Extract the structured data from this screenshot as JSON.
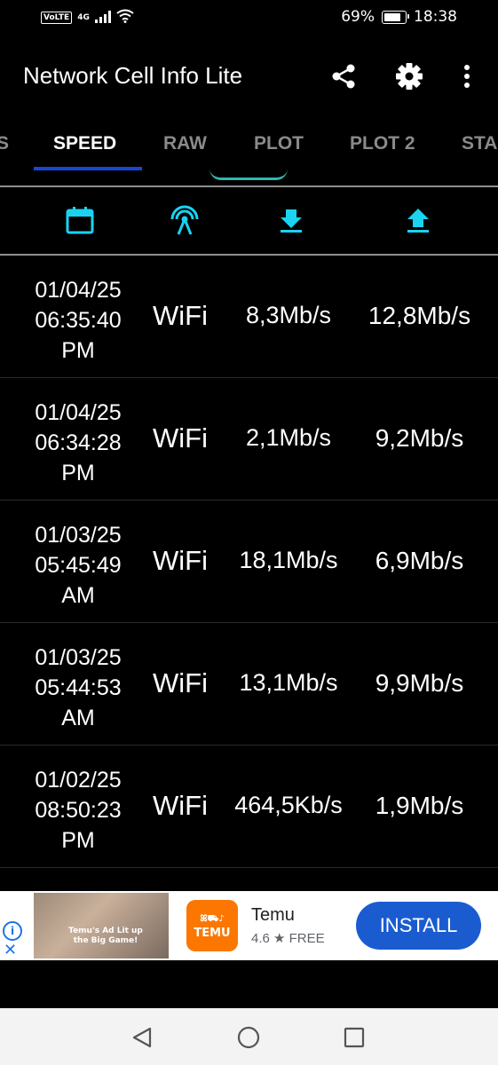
{
  "status_bar": {
    "volte": "VoLTE",
    "network": "4G",
    "battery_text": "69%",
    "battery_level": 0.69,
    "time": "18:38"
  },
  "app_bar": {
    "title": "Network Cell Info Lite",
    "icons": [
      "share-icon",
      "gear-icon",
      "more-vert-icon"
    ]
  },
  "tabs": [
    {
      "label": "S",
      "active": false
    },
    {
      "label": "SPEED",
      "active": true
    },
    {
      "label": "RAW",
      "active": false
    },
    {
      "label": "PLOT",
      "active": false
    },
    {
      "label": "PLOT 2",
      "active": false
    },
    {
      "label": "STA",
      "active": false
    }
  ],
  "toolbar": {
    "icons": [
      "calendar-icon",
      "antenna-icon",
      "download-icon",
      "upload-icon"
    ],
    "accent": "#19d3f0"
  },
  "rows": [
    {
      "date": "01/04/25",
      "time": "06:35:40",
      "ampm": "PM",
      "type": "WiFi",
      "down": "8,3Mb/s",
      "up": "12,8Mb/s"
    },
    {
      "date": "01/04/25",
      "time": "06:34:28",
      "ampm": "PM",
      "type": "WiFi",
      "down": "2,1Mb/s",
      "up": "9,2Mb/s"
    },
    {
      "date": "01/03/25",
      "time": "05:45:49",
      "ampm": "AM",
      "type": "WiFi",
      "down": "18,1Mb/s",
      "up": "6,9Mb/s"
    },
    {
      "date": "01/03/25",
      "time": "05:44:53",
      "ampm": "AM",
      "type": "WiFi",
      "down": "13,1Mb/s",
      "up": "9,9Mb/s"
    },
    {
      "date": "01/02/25",
      "time": "08:50:23",
      "ampm": "PM",
      "type": "WiFi",
      "down": "464,5Kb/s",
      "up": "1,9Mb/s"
    }
  ],
  "ad": {
    "info_icon": "info-icon",
    "close_icon": "close-icon",
    "image_text": "Temu's Ad Lit up the Big Game!",
    "logo_line1": "ꕤ⛟♪",
    "logo_line2": "TEMU",
    "name": "Temu",
    "rating": "4.6 ★  FREE",
    "install": "INSTALL"
  },
  "nav_bar": {
    "icons": [
      "back-icon",
      "home-icon",
      "recents-icon"
    ]
  }
}
